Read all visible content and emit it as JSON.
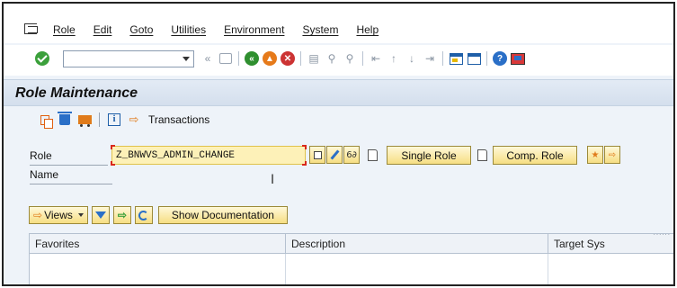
{
  "menu": {
    "items": [
      "Role",
      "Edit",
      "Goto",
      "Utilities",
      "Environment",
      "System",
      "Help"
    ]
  },
  "toolbar": {
    "command_value": "",
    "icons": [
      "check-icon",
      "back-double-icon",
      "save-icon",
      "back-icon",
      "exit-icon",
      "cancel-icon",
      "print-icon",
      "find-icon",
      "find-next-icon",
      "first-page-icon",
      "prev-page-icon",
      "next-page-icon",
      "last-page-icon",
      "new-session-icon",
      "shortcut-icon",
      "help-icon",
      "customize-layout-icon"
    ]
  },
  "title": "Role Maintenance",
  "app_toolbar": {
    "transactions_label": "Transactions"
  },
  "form": {
    "role_label": "Role",
    "role_value": "Z_BNWVS_ADMIN_CHANGE",
    "name_label": "Name",
    "single_role_label": "Single Role",
    "comp_role_label": "Comp. Role"
  },
  "views_bar": {
    "views_label": "Views",
    "show_documentation_label": "Show Documentation"
  },
  "grid": {
    "columns": [
      "Favorites",
      "Description",
      "Target Sys"
    ]
  },
  "colors": {
    "title_band": "#d4dfed",
    "button_yellow": "#f6de83",
    "input_highlight": "#fdf1b8",
    "focus_red": "#d9281c"
  }
}
